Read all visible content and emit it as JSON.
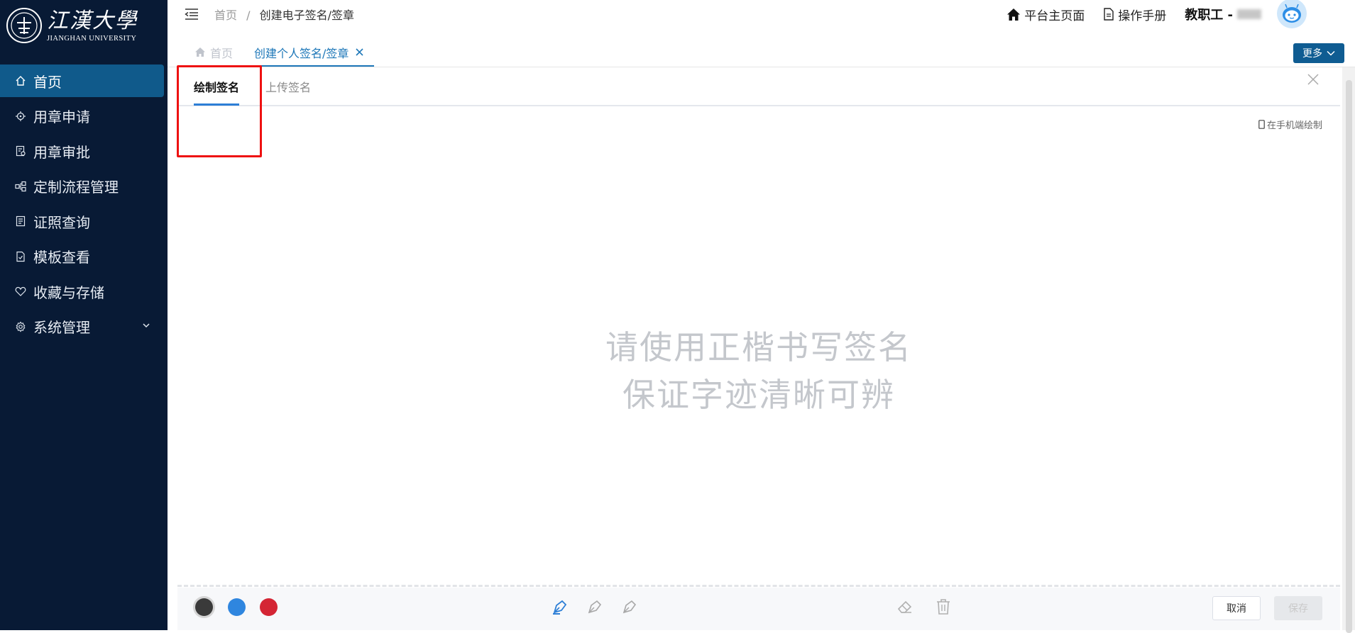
{
  "sidebar": {
    "logo": {
      "cn": "江漢大學",
      "en": "JIANGHAN UNIVERSITY"
    },
    "items": [
      {
        "label": "首页",
        "icon": "home-icon",
        "active": true
      },
      {
        "label": "用章申请",
        "icon": "target-icon"
      },
      {
        "label": "用章审批",
        "icon": "approval-icon"
      },
      {
        "label": "定制流程管理",
        "icon": "workflow-icon"
      },
      {
        "label": "证照查询",
        "icon": "license-icon"
      },
      {
        "label": "模板查看",
        "icon": "template-icon"
      },
      {
        "label": "收藏与存储",
        "icon": "heart-icon"
      },
      {
        "label": "系统管理",
        "icon": "gear-icon",
        "expandable": true
      }
    ]
  },
  "header": {
    "breadcrumb": {
      "home": "首页",
      "separator": "/",
      "current": "创建电子签名/签章"
    },
    "platform_link": "平台主页面",
    "manual_link": "操作手册",
    "user_role": "教职工 -"
  },
  "tabs": {
    "home": "首页",
    "current": "创建个人签名/签章",
    "more": "更多"
  },
  "panel": {
    "tab_draw": "绘制签名",
    "tab_upload": "上传签名",
    "mobile_link": "在手机端绘制",
    "hint_line1": "请使用正楷书写签名",
    "hint_line2": "保证字迹清晰可辨",
    "cancel": "取消",
    "save": "保存"
  },
  "colors": {
    "sidebar_bg": "#081a35",
    "sidebar_active": "#105a8b",
    "accent": "#1d77b8",
    "pen_black": "#3a3a3a",
    "pen_blue": "#2f86df",
    "pen_red": "#d42534",
    "highlight": "#ee1111"
  }
}
